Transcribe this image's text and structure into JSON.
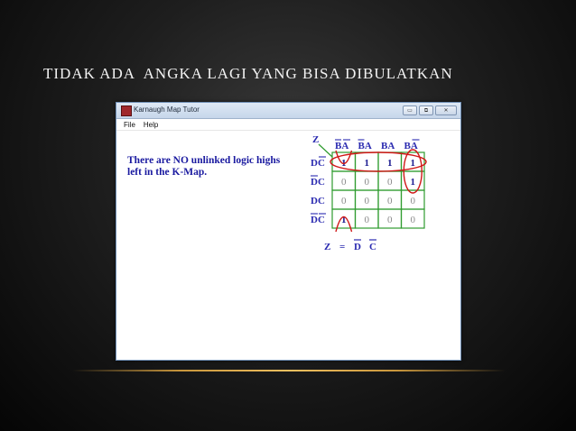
{
  "slide": {
    "title": "TIDAK ADA  ANGKA LAGI YANG BISA DIBULATKAN"
  },
  "window": {
    "title": "Karnaugh Map Tutor",
    "controls": {
      "minimize": "▭",
      "maximize": "⧉",
      "close": "✕"
    },
    "icon": "app-icon"
  },
  "menu": [
    "File",
    "Help"
  ],
  "message": {
    "line1": "There are NO unlinked logic highs",
    "line2": "left in the K-Map."
  },
  "kmap": {
    "output_label": "Z",
    "columns": [
      "BA",
      "BA",
      "BA",
      "BA"
    ],
    "rows": [
      "DC",
      "DC",
      "DC",
      "DC"
    ],
    "cells": [
      [
        "1",
        "1",
        "1",
        "1"
      ],
      [
        "0",
        "0",
        "0",
        "1"
      ],
      [
        "0",
        "0",
        "0",
        "0"
      ],
      [
        "1",
        "0",
        "0",
        "0"
      ]
    ],
    "result": {
      "lhs": "Z",
      "eq": "=",
      "terms": [
        "D",
        "C"
      ]
    },
    "colors": {
      "grid": "#2e9b2e",
      "one": "#1a1a90",
      "zero": "#8a8a8a",
      "label": "#2a2ab0",
      "loop": "#d01818"
    }
  }
}
